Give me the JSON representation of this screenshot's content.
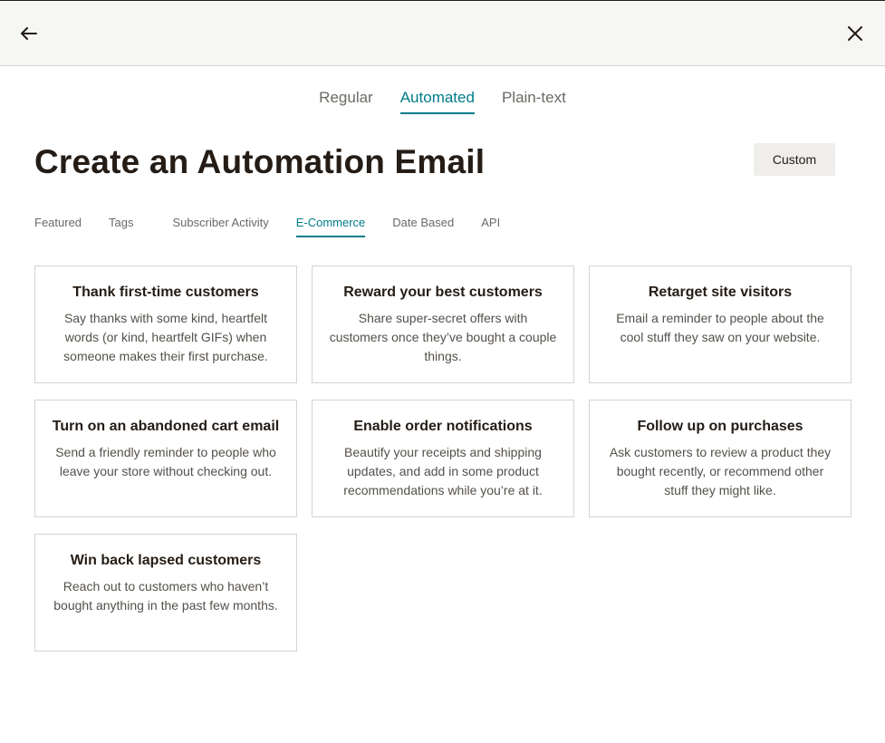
{
  "tabs": [
    "Regular",
    "Automated",
    "Plain-text"
  ],
  "title": "Create an Automation Email",
  "custom_label": "Custom",
  "categories": [
    "Featured",
    "Tags",
    "Subscriber Activity",
    "E-Commerce",
    "Date Based",
    "API"
  ],
  "cards": [
    {
      "title": "Thank first-time customers",
      "desc": "Say thanks with some kind, heartfelt words (or kind, heartfelt GIFs) when someone makes their first purchase."
    },
    {
      "title": "Reward your best customers",
      "desc": "Share super-secret offers with customers once they’ve bought a couple things."
    },
    {
      "title": "Retarget site visitors",
      "desc": "Email a reminder to people about the cool stuff they saw on your website."
    },
    {
      "title": "Turn on an abandoned cart email",
      "desc": "Send a friendly reminder to people who leave your store without checking out."
    },
    {
      "title": "Enable order notifications",
      "desc": "Beautify your receipts and shipping updates, and add in some product recommendations while you’re at it."
    },
    {
      "title": "Follow up on purchases",
      "desc": "Ask customers to review a product they bought recently, or recommend other stuff they might like."
    },
    {
      "title": "Win back lapsed customers",
      "desc": "Reach out to customers who haven’t bought anything in the past few months."
    }
  ],
  "colors": {
    "accent": "#007c89",
    "text": "#241c15",
    "topbar": "#f6f6f4"
  },
  "icons": {
    "back": "arrow-left-icon",
    "close": "close-icon"
  }
}
